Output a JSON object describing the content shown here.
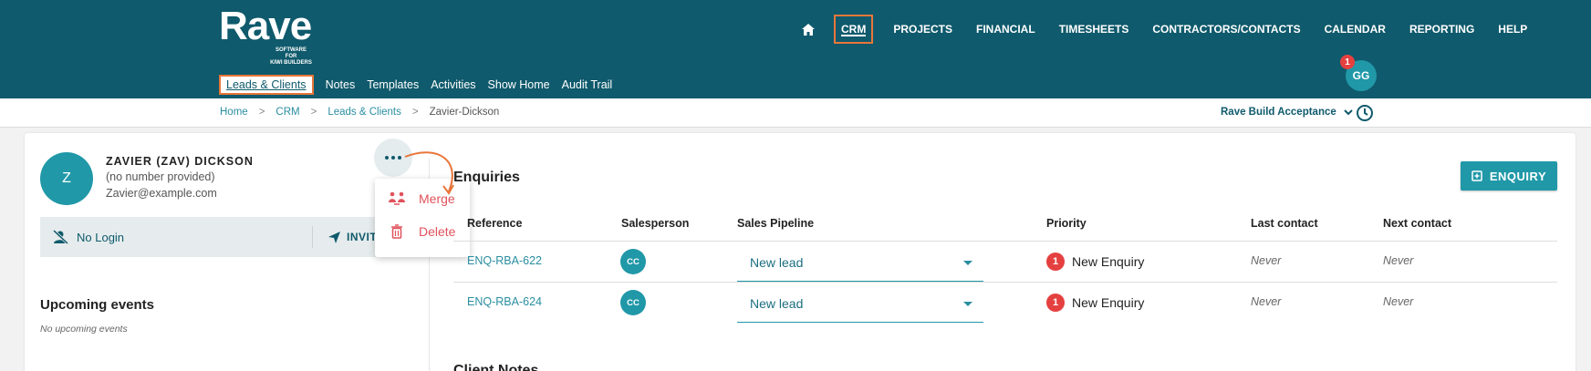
{
  "brand": {
    "name": "Rave",
    "tagline_line1": "SOFTWARE FOR",
    "tagline_line2": "KIWI BUILDERS"
  },
  "main_nav": [
    "CRM",
    "PROJECTS",
    "FINANCIAL",
    "TIMESHEETS",
    "CONTRACTORS/CONTACTS",
    "CALENDAR",
    "REPORTING",
    "HELP"
  ],
  "sub_nav": [
    "Leads & Clients",
    "Notes",
    "Templates",
    "Activities",
    "Show Home",
    "Audit Trail"
  ],
  "user": {
    "initials": "GG",
    "notification_count": "1"
  },
  "breadcrumb": {
    "home": "Home",
    "crm": "CRM",
    "leads": "Leads & Clients",
    "current": "Zavier-Dickson",
    "sep": ">"
  },
  "workspace": "Rave Build Acceptance",
  "client": {
    "initial": "Z",
    "name": "ZAVIER (ZAV) DICKSON",
    "phone": "(no number provided)",
    "email": "Zavier@example.com",
    "login_status": "No Login",
    "invite_label": "INVIT"
  },
  "menu": {
    "merge": "Merge",
    "delete": "Delete"
  },
  "upcoming": {
    "title": "Upcoming events",
    "empty": "No upcoming events"
  },
  "enquiries": {
    "title": "Enquiries",
    "add_button": "ENQUIRY",
    "columns": [
      "Reference",
      "Salesperson",
      "Sales Pipeline",
      "Priority",
      "Last contact",
      "Next contact"
    ],
    "rows": [
      {
        "reference": "ENQ-RBA-622",
        "salesperson": "CC",
        "pipeline": "New lead",
        "priority_count": "1",
        "priority": "New Enquiry",
        "last_contact": "Never",
        "next_contact": "Never"
      },
      {
        "reference": "ENQ-RBA-624",
        "salesperson": "CC",
        "pipeline": "New lead",
        "priority_count": "1",
        "priority": "New Enquiry",
        "last_contact": "Never",
        "next_contact": "Never"
      }
    ]
  },
  "notes_title": "Client Notes",
  "colors": {
    "header": "#0f5a6c",
    "accent": "#2098a8",
    "highlight": "#e8763a",
    "danger": "#e0525c"
  }
}
